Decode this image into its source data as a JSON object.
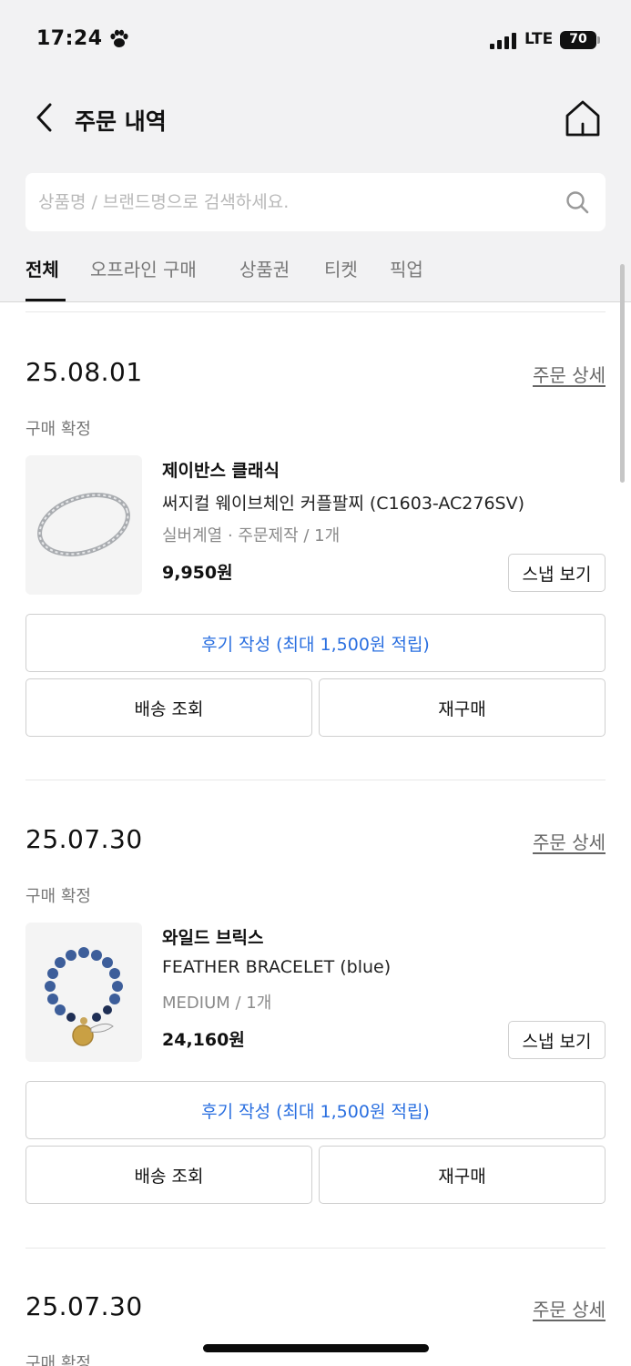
{
  "status_bar": {
    "time": "17:24",
    "network": "LTE",
    "battery": "70"
  },
  "header": {
    "title": "주문 내역"
  },
  "search": {
    "placeholder": "상품명 / 브랜드명으로 검색하세요."
  },
  "tabs": [
    {
      "label": "전체",
      "active": true
    },
    {
      "label": "오프라인 구매",
      "active": false
    },
    {
      "label": "상품권",
      "active": false
    },
    {
      "label": "티켓",
      "active": false
    },
    {
      "label": "픽업",
      "active": false
    }
  ],
  "orders": [
    {
      "date": "25.08.01",
      "detail_link": "주문 상세",
      "status": "구매 확정",
      "brand": "제이반스 클래식",
      "product": "써지컬 웨이브체인 커플팔찌 (C1603-AC276SV)",
      "option": "실버계열 · 주문제작 / 1개",
      "price": "9,950원",
      "snap_button": "스냅 보기",
      "review_button": "후기 작성 (최대 1,500원 적립)",
      "shipping_button": "배송 조회",
      "rebuy_button": "재구매"
    },
    {
      "date": "25.07.30",
      "detail_link": "주문 상세",
      "status": "구매 확정",
      "brand": "와일드 브릭스",
      "product": "FEATHER BRACELET (blue)",
      "option": "MEDIUM / 1개",
      "price": "24,160원",
      "snap_button": "스냅 보기",
      "review_button": "후기 작성 (최대 1,500원 적립)",
      "shipping_button": "배송 조회",
      "rebuy_button": "재구매"
    },
    {
      "date": "25.07.30",
      "detail_link": "주문 상세",
      "status": "구매 확정"
    }
  ],
  "colors": {
    "accent_link": "#2a6fe0",
    "header_bg": "#f2f2f3"
  }
}
